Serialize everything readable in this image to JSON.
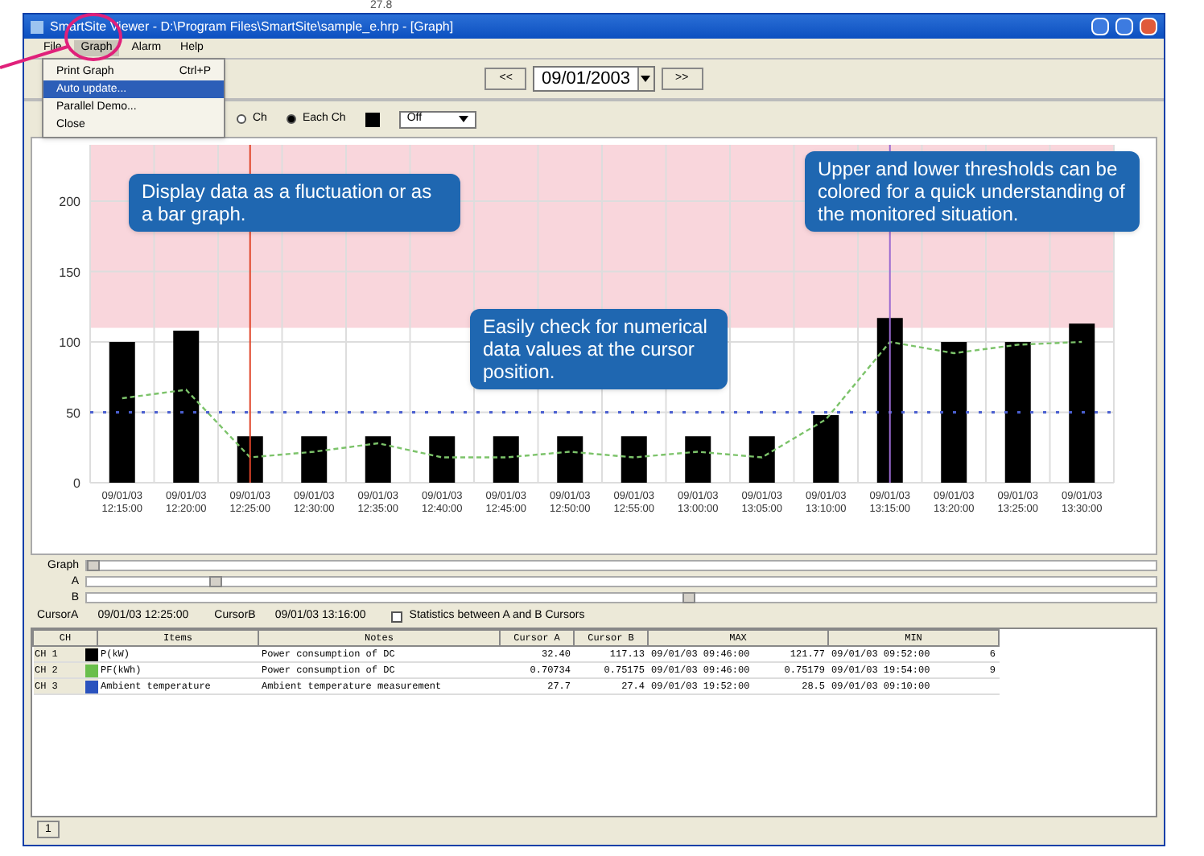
{
  "background_text": "27.8",
  "window": {
    "title": "SmartSite Viewer - D:\\Program Files\\SmartSite\\sample_e.hrp - [Graph]"
  },
  "menu": [
    {
      "label": "File",
      "selected": false
    },
    {
      "label": "Graph",
      "selected": true
    },
    {
      "label": "Alarm",
      "selected": false
    },
    {
      "label": "Help",
      "selected": false
    }
  ],
  "dropdown": [
    {
      "label": "Print Graph",
      "shortcut": "Ctrl+P",
      "selected": false
    },
    {
      "label": "Auto update...",
      "selected": true
    },
    {
      "label": "Parallel Demo...",
      "selected": false
    },
    {
      "label": "Close",
      "selected": false
    }
  ],
  "toolbar": {
    "prev": "<<",
    "date": "09/01/2003",
    "next": ">>"
  },
  "options": {
    "radios": [
      {
        "label": "Ch",
        "selected": false
      },
      {
        "label": "Each Ch",
        "selected": true
      }
    ],
    "color": "#000000",
    "select": "Off"
  },
  "chart": {
    "chart_data": {
      "type": "bar",
      "ylim": [
        0,
        240
      ],
      "yticks": [
        0,
        50,
        100,
        150,
        200
      ],
      "categories": [
        "09/01/03 12:15:00",
        "09/01/03 12:20:00",
        "09/01/03 12:25:00",
        "09/01/03 12:30:00",
        "09/01/03 12:35:00",
        "09/01/03 12:40:00",
        "09/01/03 12:45:00",
        "09/01/03 12:50:00",
        "09/01/03 12:55:00",
        "09/01/03 13:00:00",
        "09/01/03 13:05:00",
        "09/01/03 13:10:00",
        "09/01/03 13:15:00",
        "09/01/03 13:20:00",
        "09/01/03 13:25:00",
        "09/01/03 13:30:00"
      ],
      "series": [
        {
          "type": "bar",
          "color": "#000000",
          "values": [
            100,
            108,
            33,
            33,
            33,
            33,
            33,
            33,
            33,
            33,
            33,
            48,
            117,
            100,
            100,
            113
          ]
        },
        {
          "type": "line",
          "color": "#7cc36a",
          "line_style": "dashed",
          "values": [
            60,
            66,
            18,
            22,
            28,
            18,
            18,
            22,
            18,
            22,
            18,
            45,
            100,
            92,
            98,
            100
          ]
        }
      ],
      "grid": true,
      "bands": [
        {
          "axis": "y",
          "from": 110,
          "to": 240,
          "color": "#f9d6dc"
        }
      ],
      "ref_lines": [
        {
          "axis": "y",
          "value": 50,
          "color": "#4a5fd0"
        },
        {
          "axis": "x",
          "value": "09/01/03 12:25:00",
          "color": "#e0452a"
        },
        {
          "axis": "x",
          "value": "09/01/03 13:15:00",
          "color": "#9a6ad0"
        }
      ]
    }
  },
  "callouts": [
    "Display data as a fluctuation or as a bar graph.",
    "Upper and lower thresholds can be colored for a quick understanding of the monitored situation.",
    "Easily check for numerical data values at the cursor position."
  ],
  "sliders": [
    {
      "label": "Graph",
      "level": 0.0
    },
    {
      "label": "A",
      "level": 0.12
    },
    {
      "label": "B",
      "level": 0.58
    }
  ],
  "cursors": [
    {
      "label": "CursorA",
      "value": "09/01/03 12:25:00"
    },
    {
      "label": "CursorB",
      "value": "09/01/03 13:16:00"
    }
  ],
  "statistics": {
    "label": "Statistics between A and B Cursors",
    "checked": false
  },
  "table": {
    "columns": [
      {
        "label": "CH"
      },
      {
        "label": "Items"
      },
      {
        "label": "Notes"
      },
      {
        "label": "Cursor A"
      },
      {
        "label": "Cursor B"
      },
      {
        "label": "MAX",
        "colspan": 2
      },
      {
        "label": "MIN",
        "colspan": 2
      }
    ],
    "rows": [
      {
        "color": "#000000",
        "cells": [
          "CH 1",
          "P(kW)",
          "Power consumption of DC",
          "32.40",
          "117.13",
          "09/01/03 09:46:00",
          "121.77",
          "09/01/03 09:52:00",
          "6"
        ]
      },
      {
        "color": "#6abf4b",
        "cells": [
          "CH 2",
          "PF(kWh)",
          "Power consumption of DC",
          "0.70734",
          "0.75175",
          "09/01/03 09:46:00",
          "0.75179",
          "09/01/03 19:54:00",
          "9"
        ]
      },
      {
        "color": "#2a52be",
        "cells": [
          "CH 3",
          "Ambient temperature",
          "Ambient temperature measurement",
          "27.7",
          "27.4",
          "09/01/03 19:52:00",
          "28.5",
          "09/01/03 09:10:00",
          ""
        ]
      }
    ]
  },
  "table_page": "1"
}
